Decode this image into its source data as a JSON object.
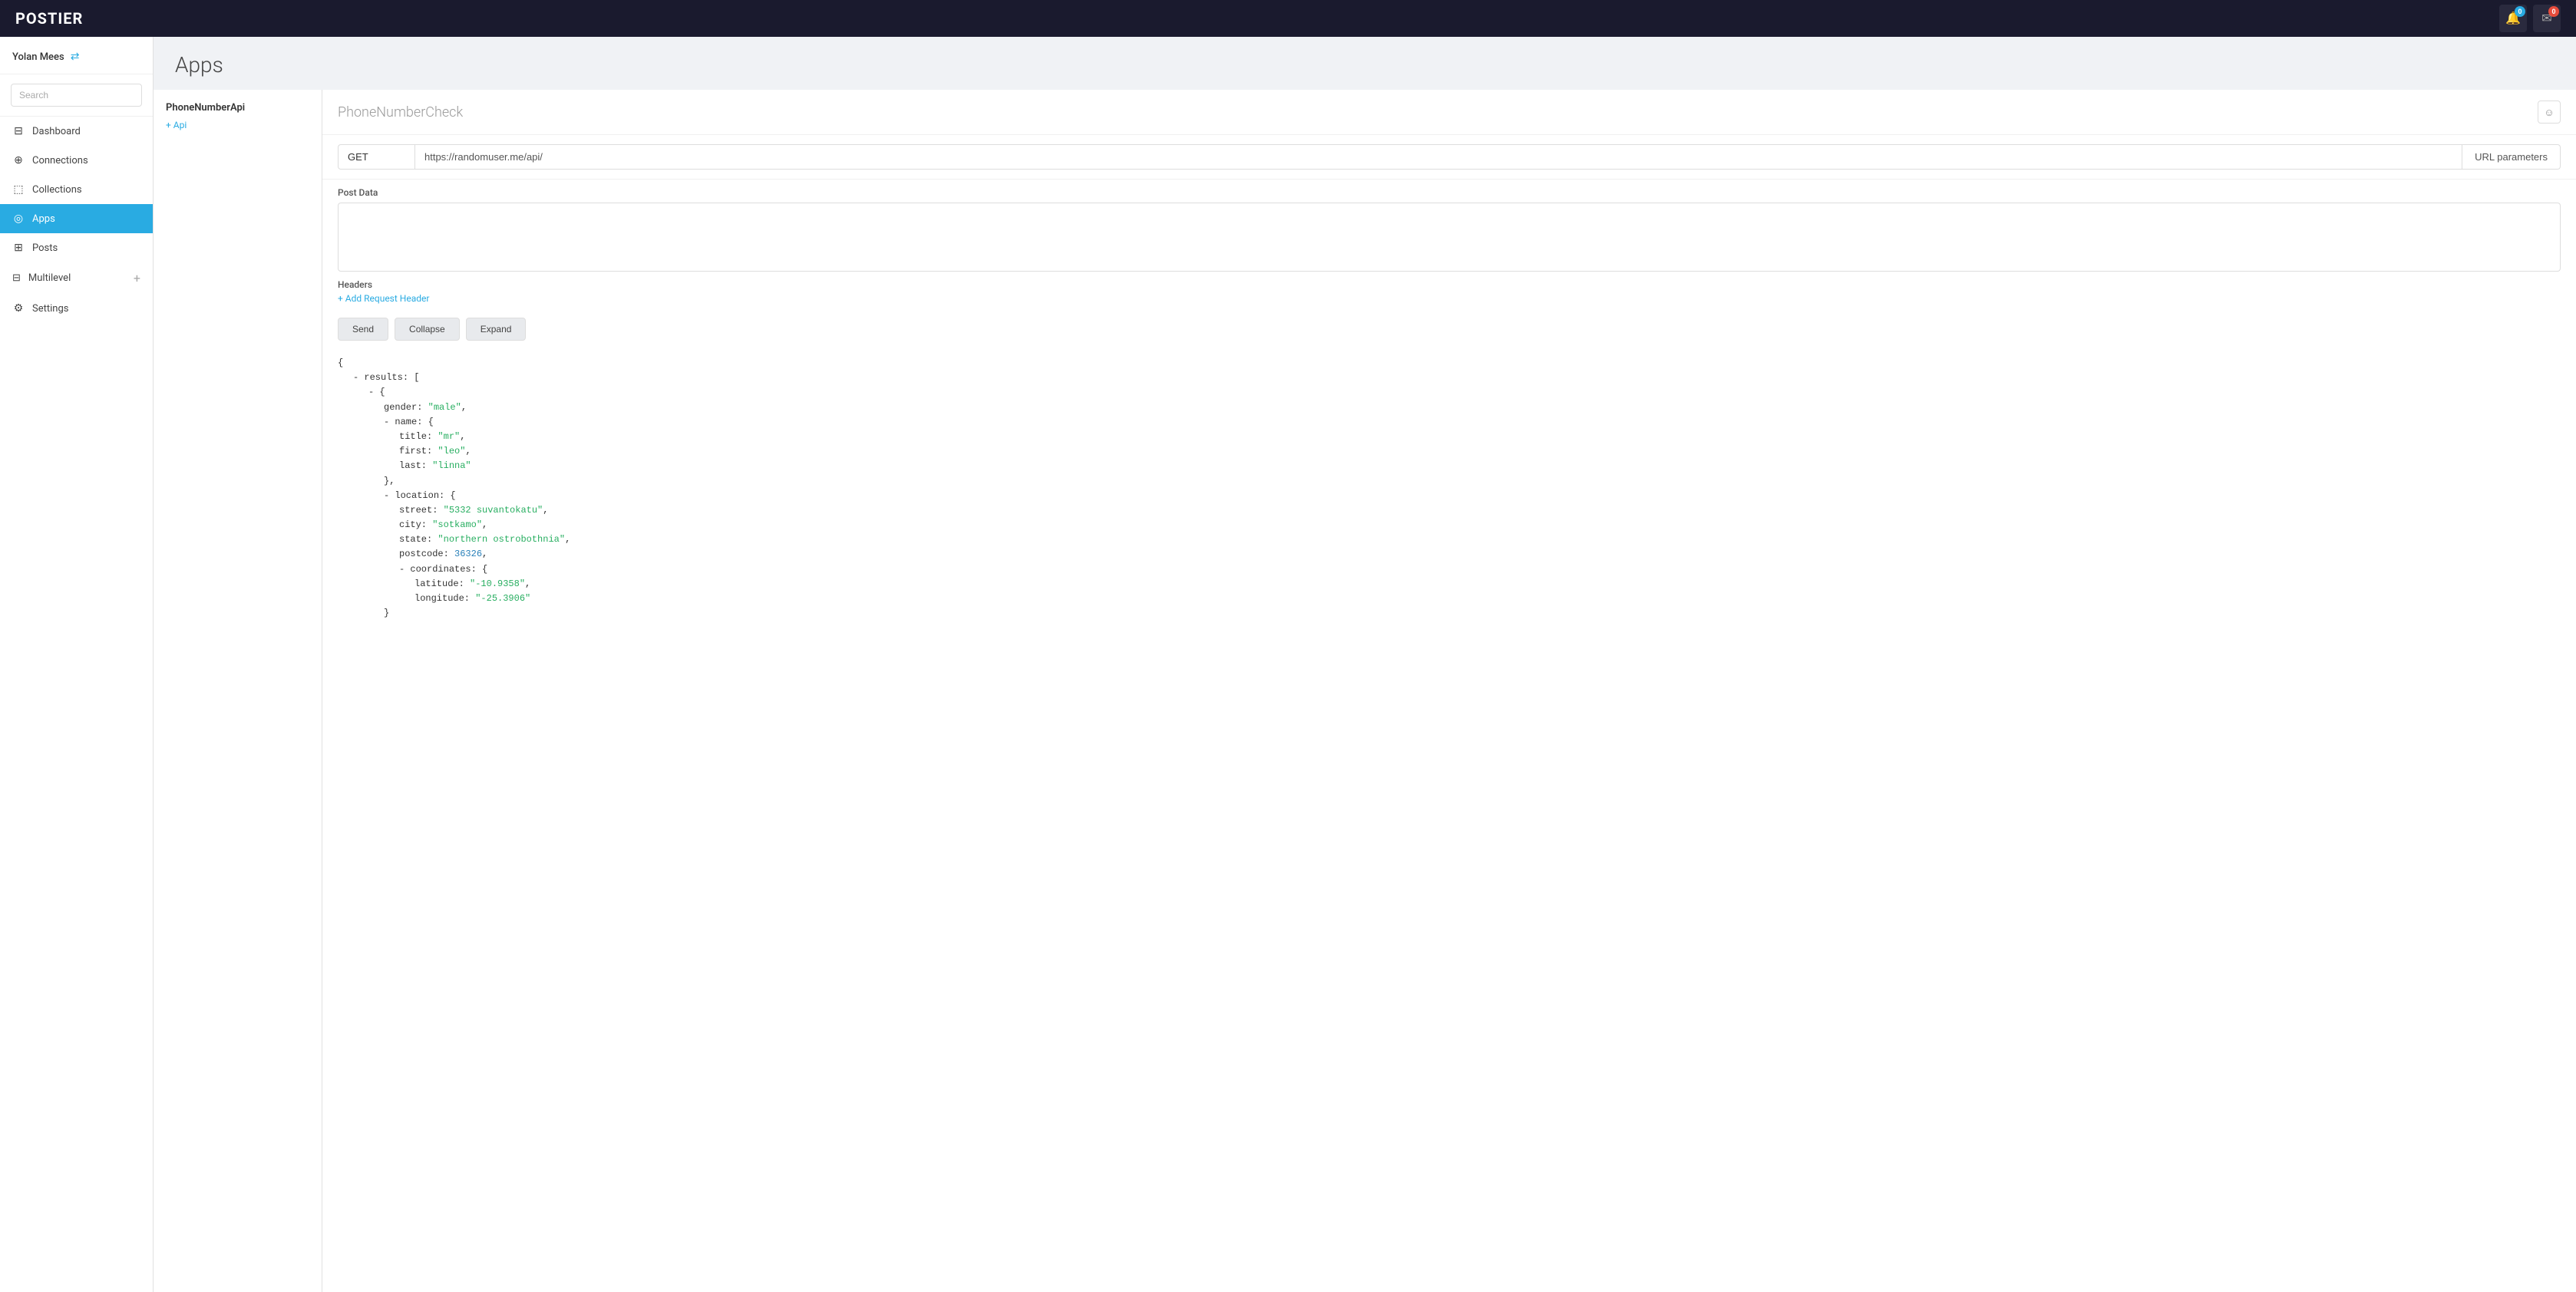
{
  "app": {
    "logo_prefix": "POST",
    "logo_suffix": "IER"
  },
  "topbar": {
    "bell_badge": "0",
    "mail_badge": "0"
  },
  "sidebar": {
    "username": "Yolan Mees",
    "search_placeholder": "Search",
    "nav_items": [
      {
        "id": "dashboard",
        "label": "Dashboard",
        "icon": "⊟"
      },
      {
        "id": "connections",
        "label": "Connections",
        "icon": "⊕"
      },
      {
        "id": "collections",
        "label": "Collections",
        "icon": "⬚"
      },
      {
        "id": "apps",
        "label": "Apps",
        "icon": "◎",
        "active": true
      },
      {
        "id": "posts",
        "label": "Posts",
        "icon": "⊞"
      },
      {
        "id": "multilevel",
        "label": "Multilevel",
        "icon": "⊟"
      },
      {
        "id": "settings",
        "label": "Settings",
        "icon": "⚙"
      }
    ]
  },
  "page": {
    "title": "Apps"
  },
  "left_panel": {
    "api_name": "PhoneNumberApi",
    "add_api_label": "+ Api"
  },
  "right_panel": {
    "endpoint_name": "PhoneNumberCheck",
    "method": "GET",
    "url": "https://randomuser.me/api/",
    "url_params_label": "URL parameters",
    "post_data_label": "Post Data",
    "headers_label": "Headers",
    "add_header_label": "+ Add Request Header",
    "buttons": [
      "Send",
      "Collapse",
      "Expand"
    ]
  },
  "json_output": {
    "lines": [
      {
        "indent": 0,
        "text": "{"
      },
      {
        "indent": 1,
        "text": "- results: ["
      },
      {
        "indent": 2,
        "text": "- {"
      },
      {
        "indent": 3,
        "key": "gender",
        "value": "\"male\"",
        "type": "string",
        "comma": true
      },
      {
        "indent": 3,
        "text": "- name: {"
      },
      {
        "indent": 4,
        "key": "title",
        "value": "\"mr\"",
        "type": "string",
        "comma": true
      },
      {
        "indent": 4,
        "key": "first",
        "value": "\"leo\"",
        "type": "string",
        "comma": true
      },
      {
        "indent": 4,
        "key": "last",
        "value": "\"linna\"",
        "type": "string"
      },
      {
        "indent": 3,
        "text": "},"
      },
      {
        "indent": 3,
        "text": "- location: {"
      },
      {
        "indent": 4,
        "key": "street",
        "value": "\"5332 suvantokatu\"",
        "type": "string",
        "comma": true
      },
      {
        "indent": 4,
        "key": "city",
        "value": "\"sotkamo\"",
        "type": "string",
        "comma": true
      },
      {
        "indent": 4,
        "key": "state",
        "value": "\"northern ostrobothnia\"",
        "type": "string",
        "comma": true
      },
      {
        "indent": 4,
        "key": "postcode",
        "value": "36326",
        "type": "number",
        "comma": true
      },
      {
        "indent": 4,
        "text": "- coordinates: {"
      },
      {
        "indent": 5,
        "key": "latitude",
        "value": "\"-10.9358\"",
        "type": "string",
        "comma": true
      },
      {
        "indent": 5,
        "key": "longitude",
        "value": "\"-25.3906\"",
        "type": "string"
      },
      {
        "indent": 3,
        "text": "}"
      }
    ]
  }
}
